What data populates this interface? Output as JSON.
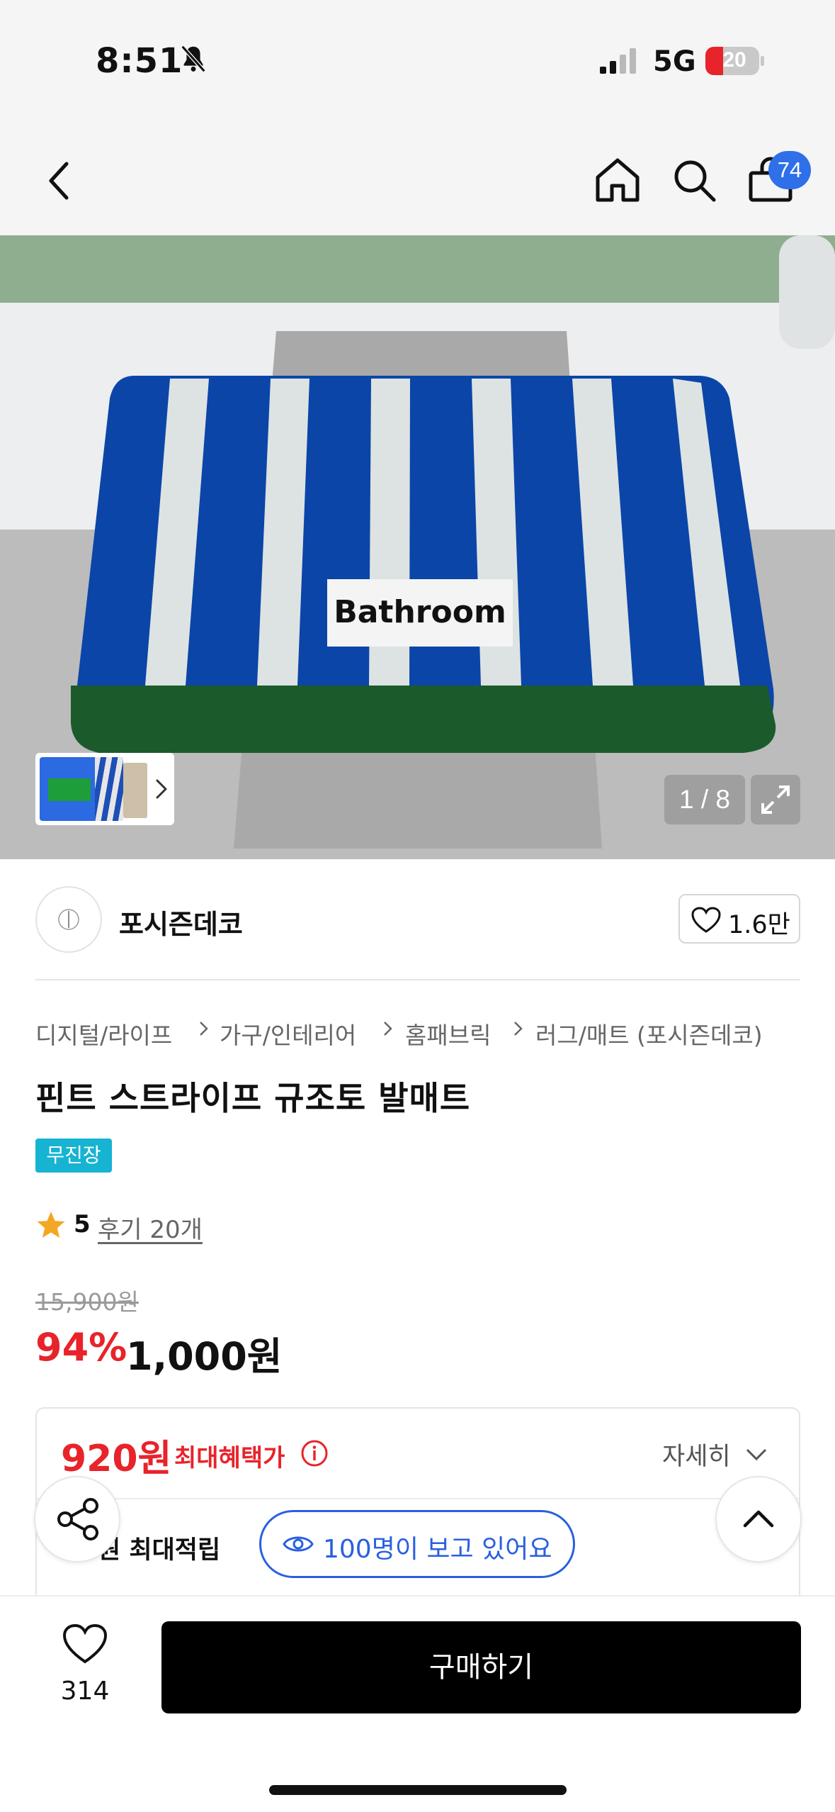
{
  "status_bar": {
    "time": "8:51",
    "network": "5G",
    "battery": "20",
    "icons": [
      "bell-slash-icon",
      "signal-icon",
      "battery-icon"
    ]
  },
  "nav": {
    "icons": [
      "back-icon",
      "home-icon",
      "search-icon",
      "cart-icon"
    ],
    "cart_count": "74"
  },
  "gallery": {
    "photo_text": "Bathroom",
    "counter": "1 / 8",
    "icons": [
      "chevron-right-icon",
      "expand-icon"
    ]
  },
  "seller": {
    "name": "포시즌데코",
    "likes": "1.6만"
  },
  "breadcrumb": [
    "디지털/라이프",
    "가구/인테리어",
    "홈패브릭",
    "러그/매트 (포시즌데코)"
  ],
  "product": {
    "title": "핀트 스트라이프 규조토 발매트",
    "badge": "무진장",
    "rating": "5",
    "review": "후기 20개",
    "original_price": "15,900원",
    "discount": "94%",
    "price": "1,000원"
  },
  "benefit": {
    "max_price": "920원",
    "max_label": "최대혜택가",
    "detail": "자세히",
    "points": "원 최대적립",
    "viewing": "100명이 보고 있어요"
  },
  "bottom": {
    "wishlist_count": "314",
    "buy_label": "구매하기"
  },
  "colors": {
    "accent_red": "#e8232a",
    "accent_blue": "#2a5fe0",
    "badge_cyan": "#16b3d3",
    "buy_button": "#000000"
  }
}
